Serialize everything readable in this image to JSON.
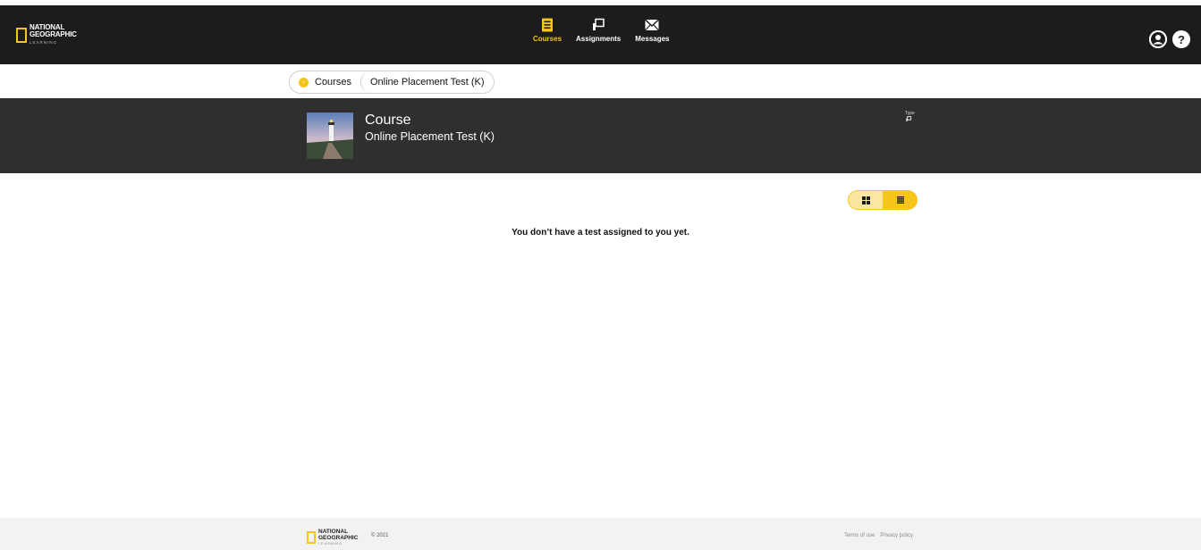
{
  "brand": {
    "line1": "NATIONAL",
    "line2": "GEOGRAPHIC",
    "line3": "LEARNING",
    "accent": "#f5c518",
    "dark": "#1c1c1c"
  },
  "nav": {
    "items": [
      {
        "label": "Courses",
        "icon": "book-icon",
        "active": true
      },
      {
        "label": "Assignments",
        "icon": "assignment-icon",
        "active": false
      },
      {
        "label": "Messages",
        "icon": "envelope-icon",
        "active": false
      }
    ]
  },
  "user": {
    "profile_icon": "user-icon",
    "help_icon": "help-icon",
    "help_glyph": "?"
  },
  "breadcrumb": {
    "items": [
      "Courses",
      "Online Placement Test (K)"
    ]
  },
  "course": {
    "title": "Course",
    "name": "Online Placement Test (K)",
    "type_label": "Type"
  },
  "view_toggle": {
    "options": [
      "grid-view-icon",
      "list-view-icon"
    ],
    "selected": "list"
  },
  "main": {
    "empty_message": "You don’t have a test assigned to you yet."
  },
  "footer": {
    "copyright": "© 2021",
    "links": [
      "Terms of use",
      "Privacy policy"
    ]
  }
}
